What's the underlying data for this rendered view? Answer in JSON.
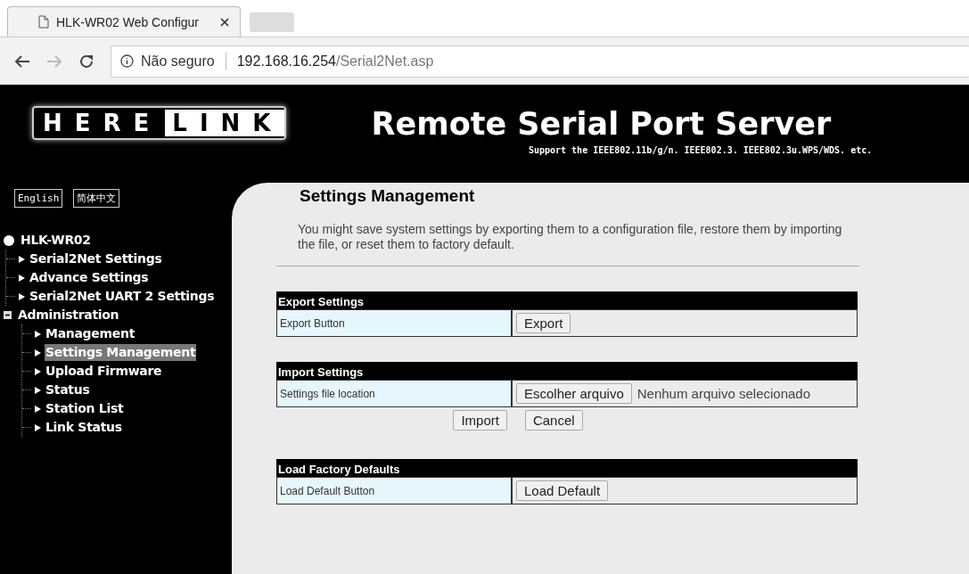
{
  "browser": {
    "tab_title": "HLK-WR02 Web Configur",
    "security": "Não seguro",
    "url_host": "192.168.16.254",
    "url_path": "/Serial2Net.asp"
  },
  "header": {
    "logo_left": "HERE",
    "logo_right": "LINK",
    "title": "Remote Serial Port Server",
    "subtitle": "Support the IEEE802.11b/g/n. IEEE802.3. IEEE802.3u.WPS/WDS. etc."
  },
  "languages": [
    "English",
    "简体中文"
  ],
  "tree": [
    {
      "label": "HLK-WR02",
      "kind": "root",
      "selected": false,
      "children": [
        {
          "label": "Serial2Net Settings",
          "selected": false
        },
        {
          "label": "Advance Settings",
          "selected": false
        },
        {
          "label": "Serial2Net UART 2 Settings",
          "selected": false
        }
      ]
    },
    {
      "label": "Administration",
      "kind": "folder",
      "expanded": true,
      "selected": false,
      "children": [
        {
          "label": "Management",
          "selected": false
        },
        {
          "label": "Settings Management",
          "selected": true
        },
        {
          "label": "Upload Firmware",
          "selected": false
        },
        {
          "label": "Status",
          "selected": false
        },
        {
          "label": "Station List",
          "selected": false
        },
        {
          "label": "Link Status",
          "selected": false
        }
      ]
    }
  ],
  "content": {
    "title": "Settings Management",
    "description": "You might save system settings by exporting them to a configuration file, restore them by importing the file, or reset them to factory default.",
    "sections": [
      {
        "heading": "Export Settings",
        "label": "Export Button",
        "kind": "button",
        "button": "Export"
      },
      {
        "heading": "Import Settings",
        "label": "Settings file location",
        "kind": "file",
        "button": "Escolher arquivo",
        "file_status": "Nenhum arquivo selecionado",
        "actions": [
          "Import",
          "Cancel"
        ]
      },
      {
        "heading": "Load Factory Defaults",
        "label": "Load Default Button",
        "kind": "button",
        "button": "Load Default"
      }
    ]
  }
}
